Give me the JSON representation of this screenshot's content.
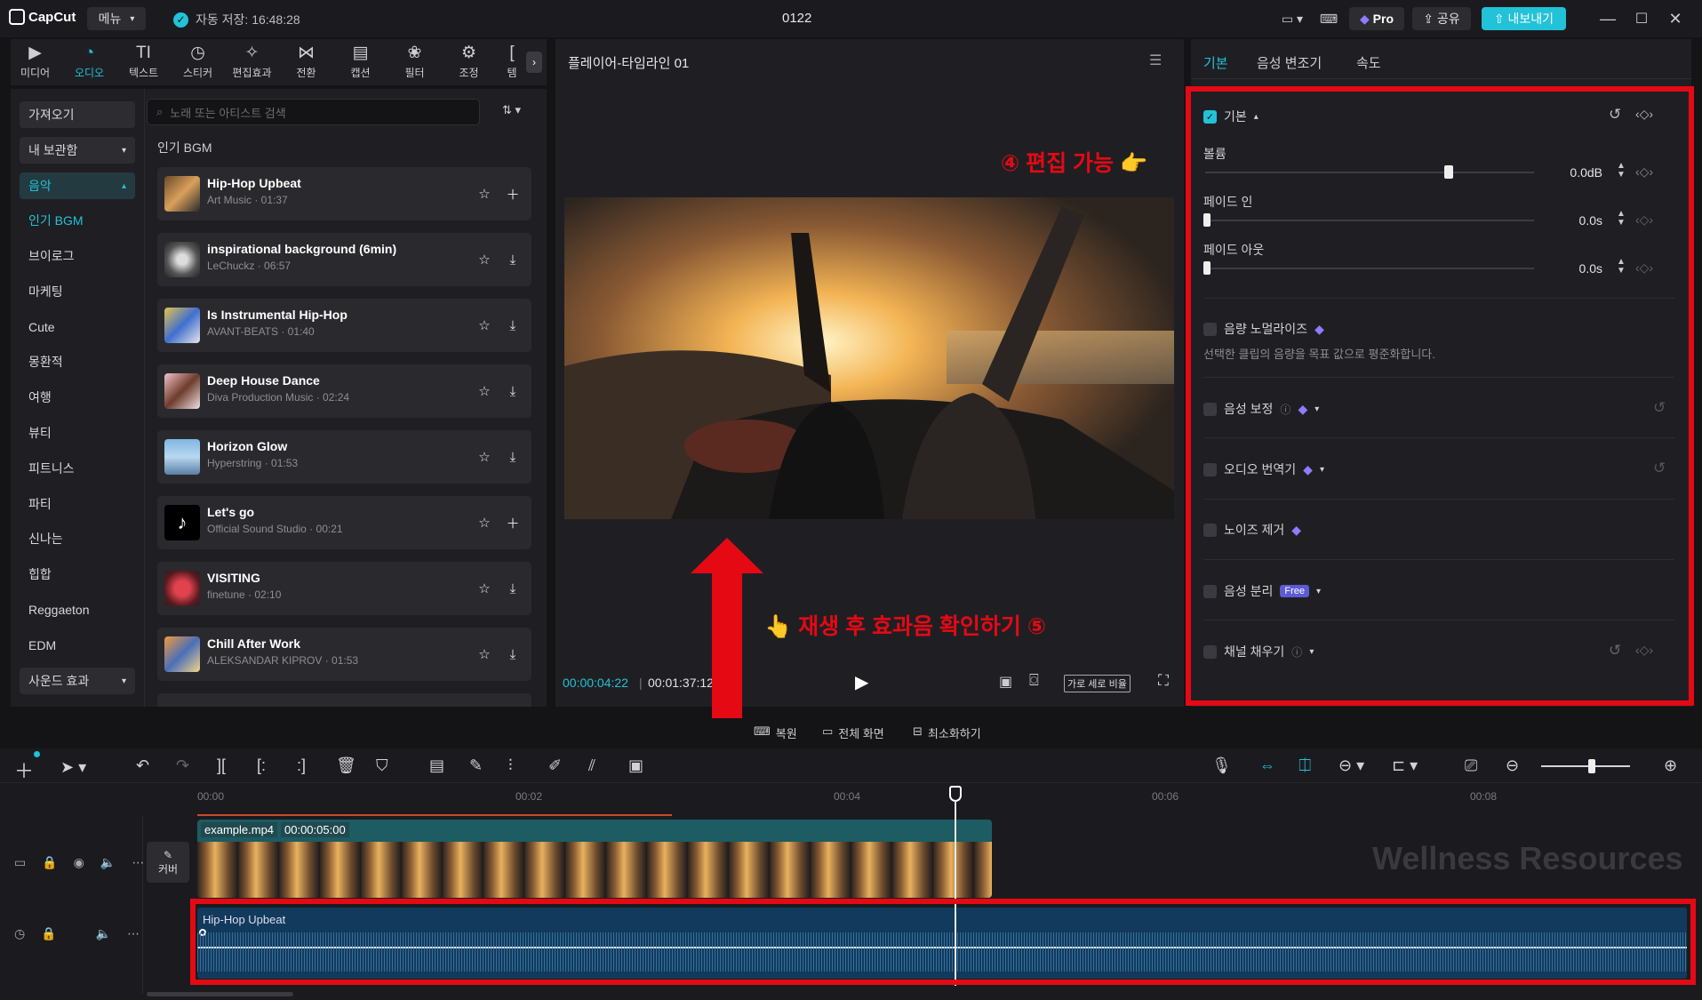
{
  "titlebar": {
    "app_name": "CapCut",
    "menu_label": "메뉴",
    "autosave": "자동 저장: 16:48:28",
    "project_title": "0122",
    "pro_label": "Pro",
    "share_label": "공유",
    "export_label": "내보내기"
  },
  "toolbar": {
    "tools": [
      {
        "label": "미디어"
      },
      {
        "label": "오디오"
      },
      {
        "label": "텍스트"
      },
      {
        "label": "스티커"
      },
      {
        "label": "편집효과"
      },
      {
        "label": "전환"
      },
      {
        "label": "캡션"
      },
      {
        "label": "필터"
      },
      {
        "label": "조정"
      },
      {
        "label": "템"
      }
    ]
  },
  "left_nav": {
    "import": "가져오기",
    "library": "내 보관함",
    "music": "음악",
    "items": [
      "인기 BGM",
      "브이로그",
      "마케팅",
      "Cute",
      "몽환적",
      "여행",
      "뷰티",
      "피트니스",
      "파티",
      "신나는",
      "힙합",
      "Reggaeton",
      "EDM"
    ],
    "sound_effects": "사운드 효과"
  },
  "search": {
    "placeholder": "노래 또는 아티스트 검색"
  },
  "section_title": "인기 BGM",
  "tracks": [
    {
      "name": "Hip-Hop Upbeat",
      "meta": "Art Music · 01:37"
    },
    {
      "name": "inspirational background (6min)",
      "meta": "LeChuckz · 06:57"
    },
    {
      "name": "Is Instrumental Hip-Hop",
      "meta": "AVANT-BEATS · 01:40"
    },
    {
      "name": "Deep House Dance",
      "meta": "Diva Production Music · 02:24"
    },
    {
      "name": "Horizon Glow",
      "meta": "Hyperstring · 01:53"
    },
    {
      "name": "Let's go",
      "meta": "Official Sound Studio · 00:21"
    },
    {
      "name": "VISITING",
      "meta": "finetune · 02:10"
    },
    {
      "name": "Chill After Work",
      "meta": "ALEKSANDAR KIPROV · 01:53"
    }
  ],
  "player": {
    "title": "플레이어-타임라인 01",
    "current_time": "00:00:04:22",
    "total_time": "00:01:37:12",
    "ratio_label": "가로 세로 비율"
  },
  "right_panel": {
    "tabs": [
      "기본",
      "음성 변조기",
      "속도"
    ],
    "basic_label": "기본",
    "volume_label": "볼륨",
    "volume_value": "0.0dB",
    "fade_in_label": "페이드 인",
    "fade_in_value": "0.0s",
    "fade_out_label": "페이드 아웃",
    "fade_out_value": "0.0s",
    "normalize_label": "음량 노멀라이즈",
    "normalize_desc": "선택한 클립의 음량을 목표 값으로 평준화합니다.",
    "voice_enhance": "음성 보정",
    "audio_translate": "오디오 번역기",
    "noise_removal": "노이즈 제거",
    "voice_separation": "음성 분리",
    "free_badge": "Free",
    "channel_fill": "채널 채우기"
  },
  "annotations": {
    "editable": "④ 편집 가능 👉",
    "play_check": "👆 재생 후 효과음 확인하기 ⑤"
  },
  "view_bar": {
    "restore": "복원",
    "fullscreen": "전체 화면",
    "minimize": "최소화하기"
  },
  "timeline": {
    "ruler": [
      "00:00",
      "00:02",
      "00:04",
      "00:06",
      "00:08"
    ],
    "video_clip_name": "example.mp4",
    "video_clip_duration": "00:00:05:00",
    "cover_label": "커버",
    "audio_clip_name": "Hip-Hop Upbeat",
    "watermark": "Wellness Resources"
  },
  "colors": {
    "accent": "#22c2d8",
    "highlight_red": "#e50914",
    "panel_bg": "#1f1f23",
    "app_bg": "#141416"
  }
}
